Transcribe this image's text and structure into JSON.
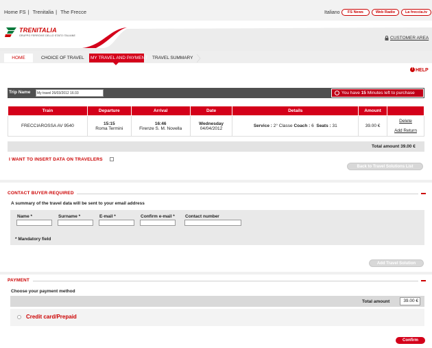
{
  "top_links": [
    "Home FS",
    "Trenitalia",
    "The Frecce"
  ],
  "top_link_separator": "|",
  "language": "Italiano",
  "top_pills": [
    "FS News",
    "Web Radio",
    "La freccia.tv"
  ],
  "brand": {
    "name": "TRENITALIA",
    "subtitle": "GRUPPO FERROVIE DELLO STATO ITALIANE"
  },
  "customer_area": "CUSTOMER AREA",
  "nav_tabs": [
    {
      "label": "HOME",
      "state": "link"
    },
    {
      "label": "CHOICE OF TRAVEL",
      "state": "done"
    },
    {
      "label": "MY TRAVEL AND PAYMENT",
      "state": "active"
    },
    {
      "label": "TRAVEL SUMMARY",
      "state": "todo"
    }
  ],
  "help": "HELP",
  "trip": {
    "label": "Trip Name",
    "value": "My travel 26/03/2012 16:33",
    "timer_prefix": "You have",
    "timer_minutes": "15",
    "timer_suffix": "Minutes left to purchase"
  },
  "train_table": {
    "headers": [
      "Train",
      "Departure",
      "Arrival",
      "Date",
      "Details",
      "Amount",
      ""
    ],
    "row": {
      "train": "FRECCIAROSSA  AV  9540",
      "dep_time": "15:15",
      "dep_station": "Roma Termini",
      "arr_time": "16:46",
      "arr_station": "Firenze S. M. Novella",
      "day": "Wednesday",
      "date": "04/04/2012",
      "service_label": "Service :",
      "service_value": "2° Classe",
      "coach_label": "Coach :",
      "coach_value": "6",
      "seats_label": "Seats :",
      "seats_value": "31",
      "amount": "39.00 €",
      "delete": "Delete",
      "add_return": "Add Return"
    },
    "total": "Total amount 39.00 €"
  },
  "insert_travelers": "I WANT TO INSERT DATA ON TRAVELERS",
  "back_button": "Back to Travel Solutions List",
  "contact": {
    "title": "CONTACT BUYER-REQUIRED",
    "summary": "A summary of the travel data will be sent to your email address",
    "fields": [
      "Name *",
      "Surname *",
      "E-mail *",
      "Confirm e-mail *",
      "Contact number"
    ],
    "mandatory": "* Mandatory field"
  },
  "add_solution_button": "Add Travel Solution",
  "payment": {
    "title": "PAYMENT",
    "choose": "Choose your payment method",
    "total_label": "Total amount",
    "total_value": "39.00 €",
    "method": "Credit card/Prepaid"
  },
  "confirm_button": "Confirm",
  "colors": {
    "brand_red": "#d4001a",
    "dark_bar": "#4f4f4f"
  }
}
